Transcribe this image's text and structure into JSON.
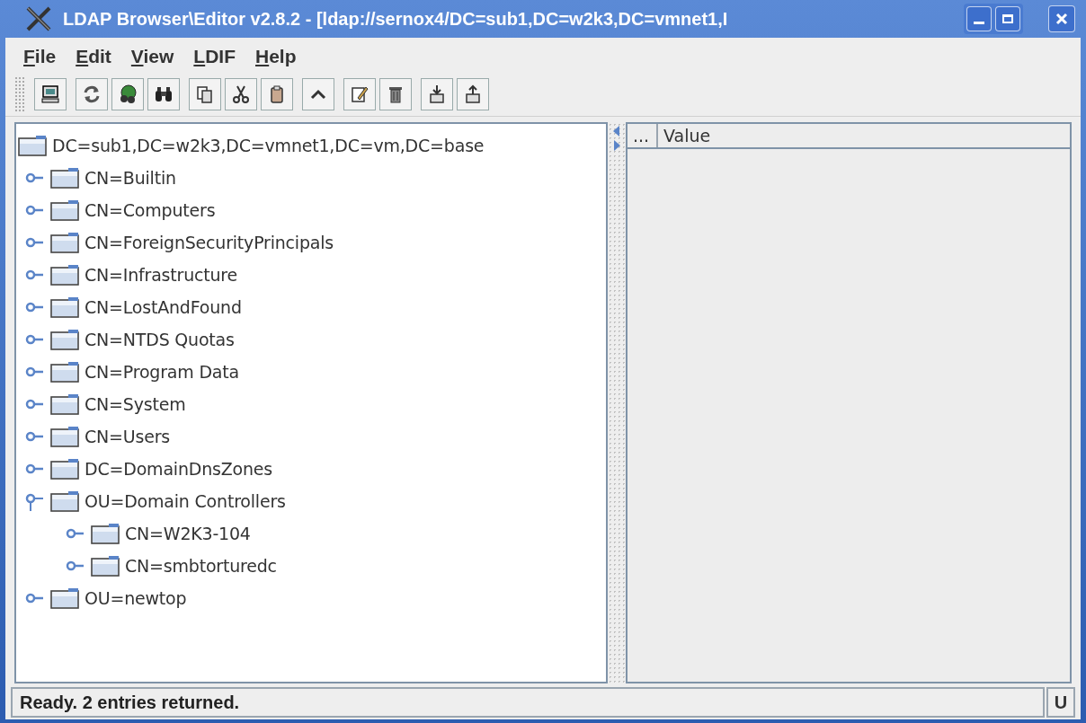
{
  "window": {
    "title": "LDAP Browser\\Editor v2.8.2 - [ldap://sernox4/DC=sub1,DC=w2k3,DC=vmnet1,I"
  },
  "menu": [
    "File",
    "Edit",
    "View",
    "LDIF",
    "Help"
  ],
  "tree": {
    "label": "DC=sub1,DC=w2k3,DC=vmnet1,DC=vm,DC=base",
    "children": [
      {
        "label": "CN=Builtin",
        "expanded": false
      },
      {
        "label": "CN=Computers",
        "expanded": false
      },
      {
        "label": "CN=ForeignSecurityPrincipals",
        "expanded": false
      },
      {
        "label": "CN=Infrastructure",
        "expanded": false
      },
      {
        "label": "CN=LostAndFound",
        "expanded": false
      },
      {
        "label": "CN=NTDS Quotas",
        "expanded": false
      },
      {
        "label": "CN=Program Data",
        "expanded": false
      },
      {
        "label": "CN=System",
        "expanded": false
      },
      {
        "label": "CN=Users",
        "expanded": false
      },
      {
        "label": "DC=DomainDnsZones",
        "expanded": false
      },
      {
        "label": "OU=Domain Controllers",
        "expanded": true,
        "children": [
          {
            "label": "CN=W2K3-104",
            "expanded": false
          },
          {
            "label": "CN=smbtorturedc",
            "expanded": false
          }
        ]
      },
      {
        "label": "OU=newtop",
        "expanded": false
      }
    ]
  },
  "table": {
    "columns": [
      "...",
      "Value"
    ]
  },
  "status_bar": {
    "message": "Ready. 2 entries returned.",
    "mode": "U"
  }
}
